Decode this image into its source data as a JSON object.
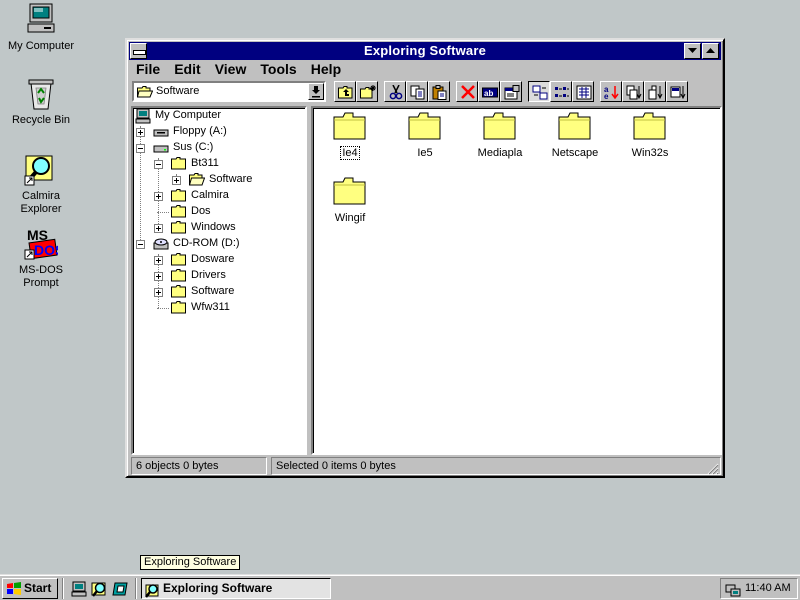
{
  "desktop": {
    "icons": [
      {
        "label": "My Computer"
      },
      {
        "label": "Recycle Bin"
      },
      {
        "label": "Calmira Explorer"
      },
      {
        "label": "MS-DOS Prompt"
      }
    ]
  },
  "window": {
    "title": "Exploring Software",
    "menu": [
      {
        "label": "File"
      },
      {
        "label": "Edit"
      },
      {
        "label": "View"
      },
      {
        "label": "Tools"
      },
      {
        "label": "Help"
      }
    ],
    "location": "Software"
  },
  "tree": [
    {
      "label": "My Computer",
      "icon": "computer-icon"
    },
    {
      "label": "Floppy (A:)",
      "icon": "floppy-drive-icon"
    },
    {
      "label": "Sus (C:)",
      "icon": "hard-drive-icon"
    },
    {
      "label": "Bt311",
      "icon": "folder-icon"
    },
    {
      "label": "Software",
      "icon": "open-folder-icon"
    },
    {
      "label": "Calmira",
      "icon": "folder-icon"
    },
    {
      "label": "Dos",
      "icon": "folder-icon"
    },
    {
      "label": "Windows",
      "icon": "folder-icon"
    },
    {
      "label": "CD-ROM (D:)",
      "icon": "cdrom-drive-icon"
    },
    {
      "label": "Dosware",
      "icon": "folder-icon"
    },
    {
      "label": "Drivers",
      "icon": "folder-icon"
    },
    {
      "label": "Software",
      "icon": "folder-icon"
    },
    {
      "label": "Wfw311",
      "icon": "folder-icon"
    }
  ],
  "files": [
    {
      "label": "Ie4"
    },
    {
      "label": "Ie5"
    },
    {
      "label": "Mediapla"
    },
    {
      "label": "Netscape"
    },
    {
      "label": "Win32s"
    },
    {
      "label": "Wingif"
    }
  ],
  "status": {
    "left": "6 objects  0 bytes",
    "right": "Selected 0 items  0 bytes"
  },
  "tooltip": "Exploring Software",
  "taskbar": {
    "start": "Start",
    "task": "Exploring Software",
    "clock": "11:40 AM"
  },
  "colors": {
    "desktop": "#c0c7c8",
    "titlebar": "#000080",
    "folder": "#ffff80"
  }
}
